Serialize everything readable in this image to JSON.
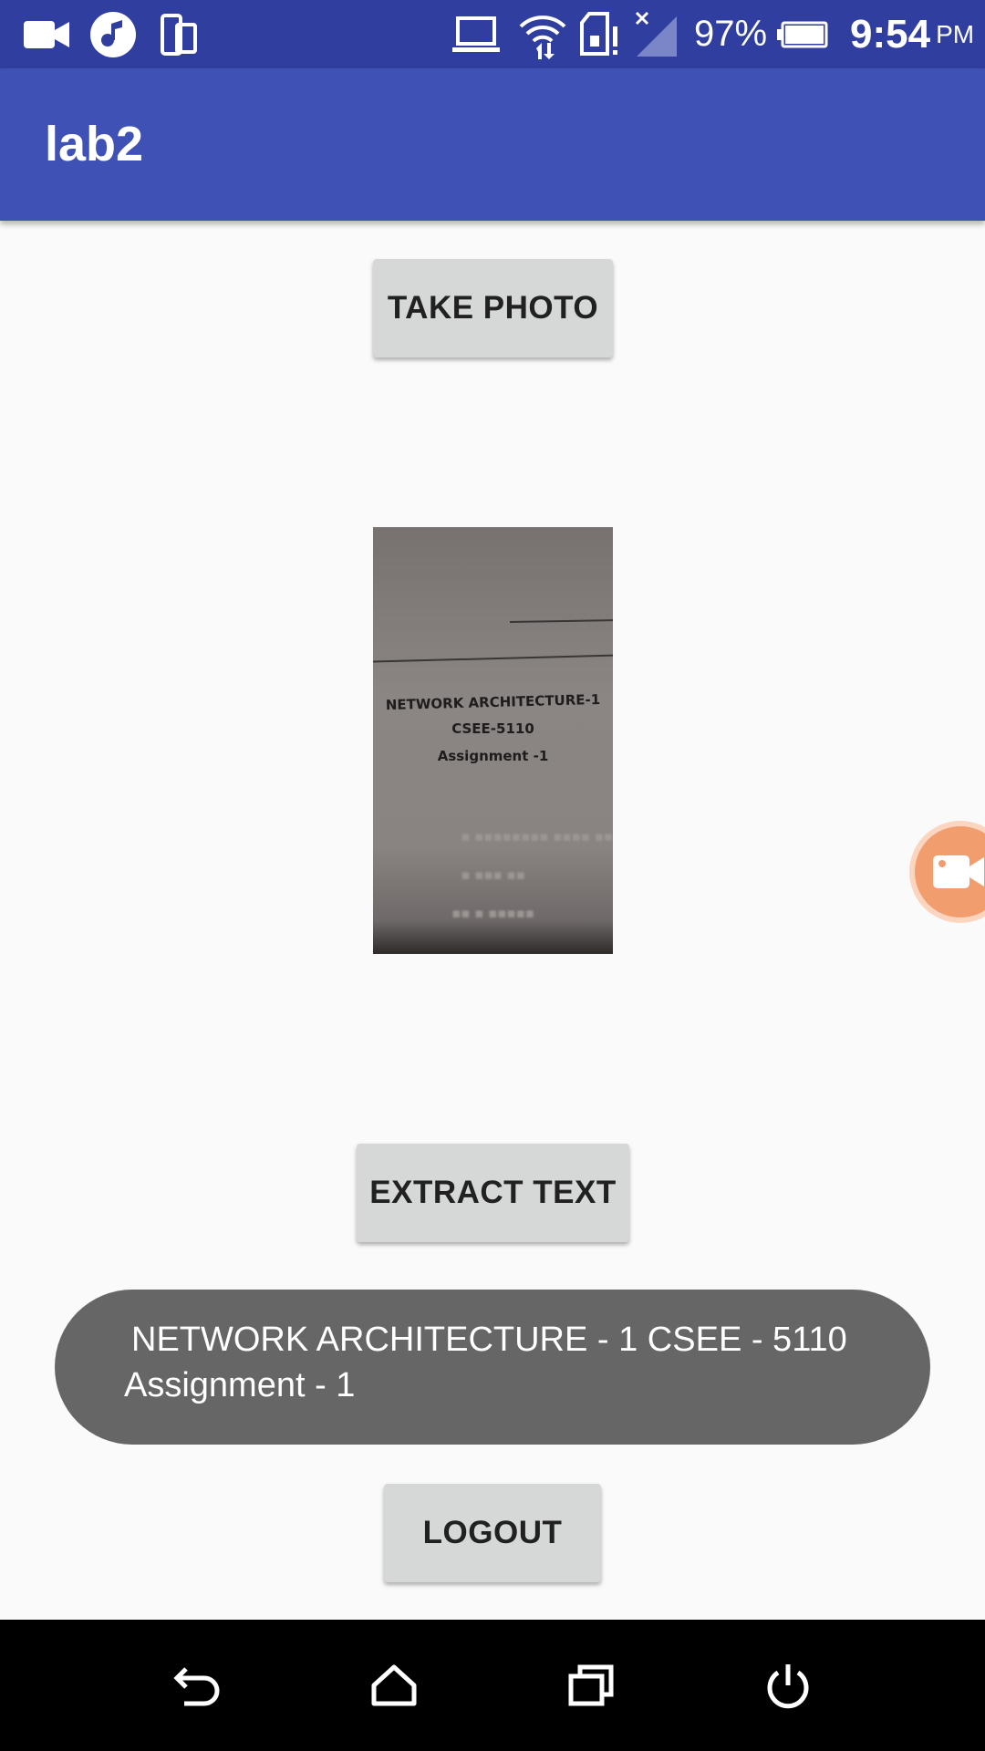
{
  "status_bar": {
    "battery_percent": "97%",
    "time": "9:54",
    "ampm": "PM",
    "icons": [
      "video-call-icon",
      "music-app-icon",
      "phone-tablet-icon",
      "laptop-icon",
      "wifi-icon",
      "sd-card-alert-icon",
      "no-signal-icon",
      "battery-icon"
    ]
  },
  "app_bar": {
    "title": "lab2"
  },
  "main": {
    "take_photo_label": "TAKE PHOTO",
    "extract_text_label": "EXTRACT TEXT",
    "logout_label": "LOGOUT",
    "photo": {
      "line1": "NETWORK ARCHITECTURE-1",
      "line2": "CSEE-5110",
      "line3": "Assignment -1"
    }
  },
  "toast": {
    "line1": "NETWORK ARCHITECTURE - 1 CSEE - 5110",
    "line2": "Assignment - 1"
  },
  "floating_button": {
    "icon": "video-camera-icon",
    "color": "#f29d6e"
  },
  "nav_bar": {
    "icons": [
      "back-icon",
      "home-icon",
      "recents-icon",
      "power-icon"
    ]
  },
  "colors": {
    "status_bar": "#303f9f",
    "app_bar": "#3f51b5",
    "button": "#d6d7d7",
    "toast": "#666666"
  }
}
